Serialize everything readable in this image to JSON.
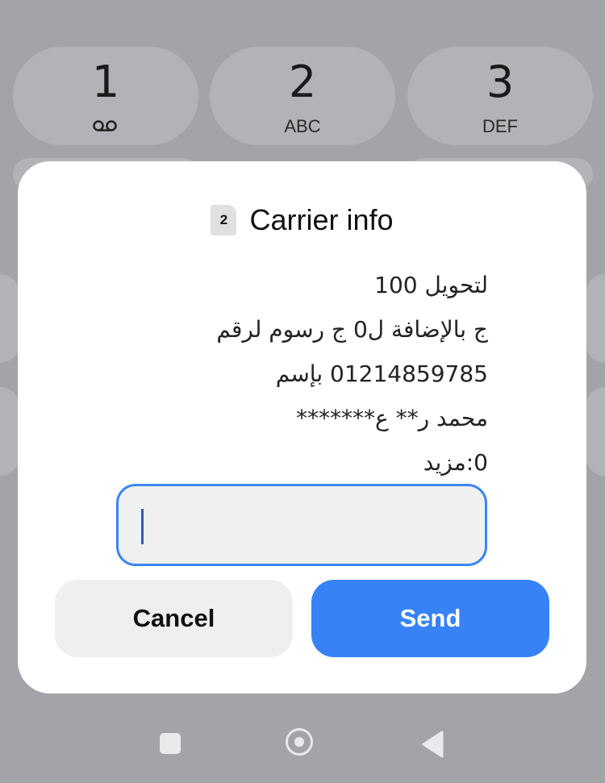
{
  "keypad": {
    "keys": [
      {
        "digit": "1",
        "letters": "",
        "icon": "voicemail-icon"
      },
      {
        "digit": "2",
        "letters": "ABC"
      },
      {
        "digit": "3",
        "letters": "DEF"
      }
    ]
  },
  "dialog": {
    "sim_badge": "2",
    "title": "Carrier info",
    "message_lines": [
      "لتحويل 100",
      "ج بالإضافة ل0 ج رسوم لرقم",
      "01214859785 بإسم",
      "محمد ر** ع*******",
      "0:مزيد"
    ],
    "input": {
      "value": "",
      "placeholder": ""
    },
    "buttons": {
      "cancel": "Cancel",
      "send": "Send"
    }
  },
  "colors": {
    "accent": "#3783f6",
    "input_border": "#3d86f2",
    "backdrop": "#a3a4a8"
  },
  "navbar": {
    "icons": [
      "recents-icon",
      "home-icon",
      "back-icon"
    ]
  }
}
